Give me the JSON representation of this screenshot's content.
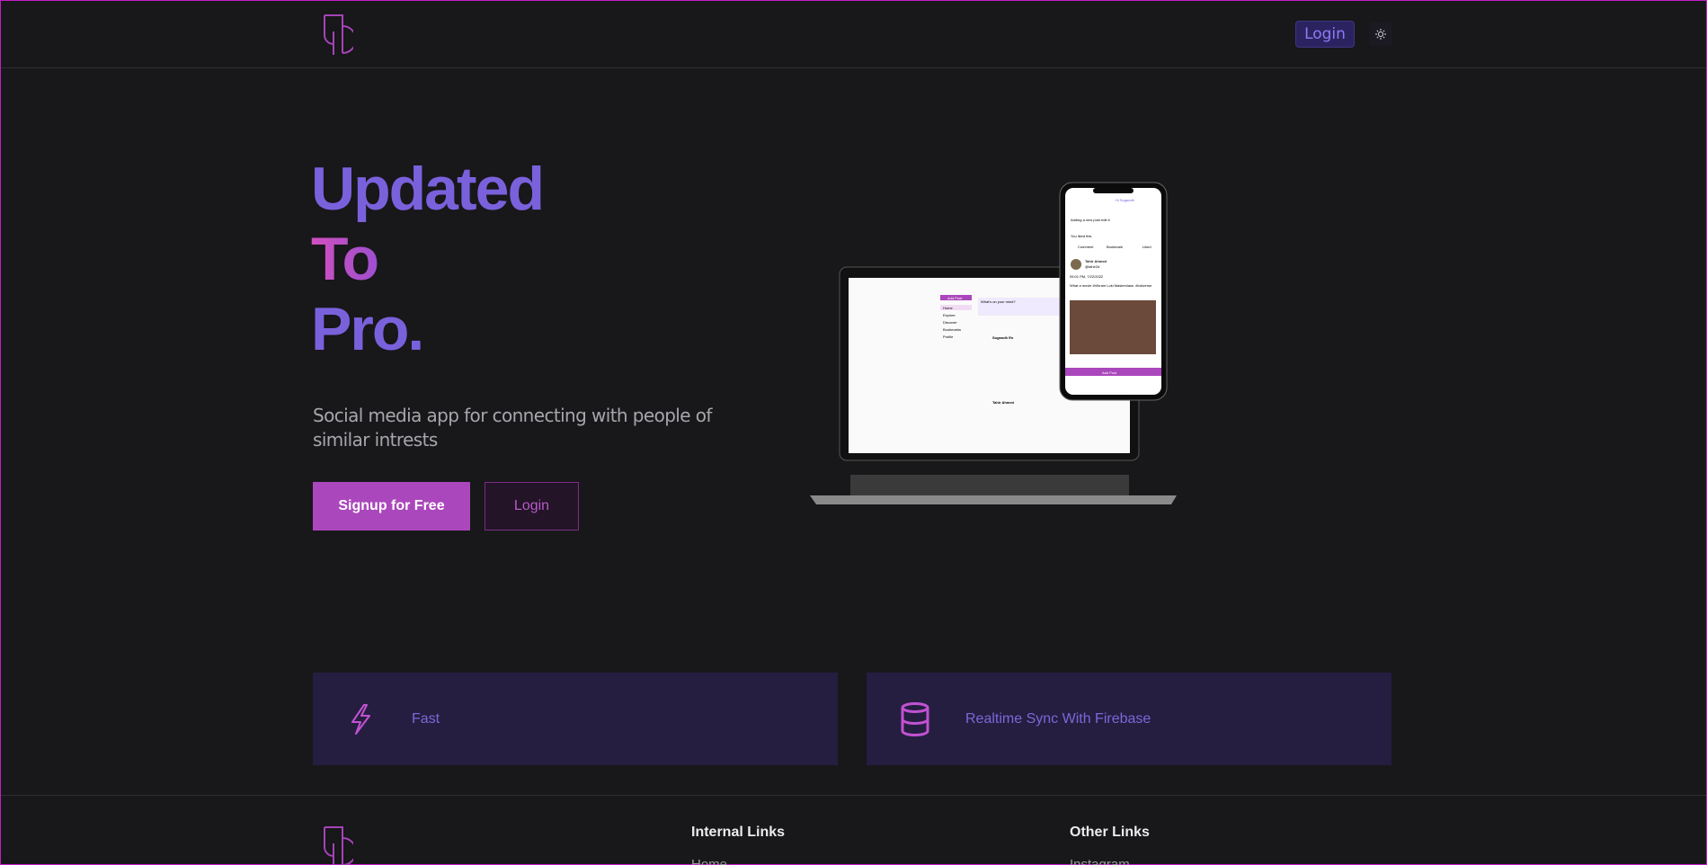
{
  "header": {
    "login_label": "Login",
    "theme_icon": "sun-icon"
  },
  "hero": {
    "line1": "Updated",
    "line2": "To",
    "line3": "Pro.",
    "subtitle": "Social media app for connecting with people of similar intrests",
    "signup_label": "Signup for Free",
    "login_label": "Login"
  },
  "mockup": {
    "phone_greeting": "Hi Sugandh",
    "phone_post": "Adding a new post edit it",
    "phone_liked": "You liked this",
    "phone_actions": [
      "Comment",
      "Bookmark",
      "Liked"
    ],
    "phone_author": "Tahir Ahmed",
    "phone_handle": "@tahir2d",
    "phone_time": "05:01 PM, 7/22/2022",
    "phone_caption": "What a movie #Vikram Loki Masterclass. #lokiverse",
    "phone_add_post": "Add Post",
    "laptop_nav": [
      "Home",
      "Explore",
      "Discover",
      "Bookmarks",
      "Profile"
    ],
    "laptop_add_post": "Add Post",
    "laptop_input_placeholder": "What's on your mind?",
    "laptop_author": "Sugandh En",
    "laptop_author2": "Tahir Ahmed"
  },
  "features": [
    {
      "icon": "lightning-icon",
      "label": "Fast"
    },
    {
      "icon": "database-icon",
      "label": "Realtime Sync With Firebase"
    }
  ],
  "footer": {
    "internal_heading": "Internal Links",
    "internal_links": [
      "Home"
    ],
    "other_heading": "Other Links",
    "other_links": [
      "Instagram"
    ]
  },
  "colors": {
    "accent": "#ab47bc",
    "primary": "#7a61dc",
    "background": "#18171a",
    "card": "#251e40"
  }
}
